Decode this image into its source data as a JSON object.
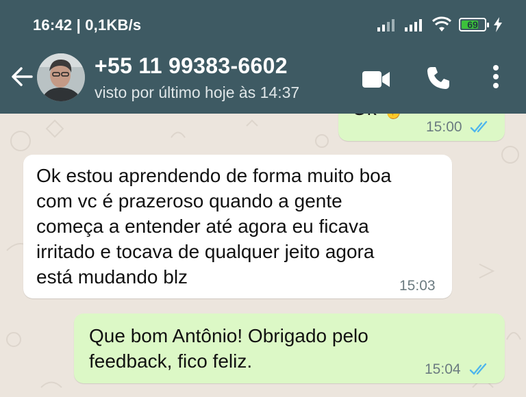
{
  "status_bar": {
    "time_speed": "16:42 | 0,1KB/s",
    "battery": "69"
  },
  "header": {
    "contact_name": "+55 11 99383-6602",
    "last_seen": "visto por último hoje às 14:37"
  },
  "messages": [
    {
      "direction": "out",
      "text": "Ok ☝",
      "time": "15:00",
      "read": true
    },
    {
      "direction": "in",
      "lines": [
        "Ok estou aprendendo de forma muito boa",
        "com vc é prazeroso quando a gente",
        "começa a entender até agora eu ficava",
        "irritado e tocava de qualquer jeito agora",
        "está mudando blz"
      ],
      "time": "15:03"
    },
    {
      "direction": "out",
      "lines": [
        "Que bom Antônio! Obrigado pelo",
        "feedback, fico feliz."
      ],
      "time": "15:04",
      "read": true
    }
  ],
  "colors": {
    "header": "#3e5a63",
    "chat_bg": "#ece5dd",
    "incoming": "#ffffff",
    "outgoing": "#dcf8c6",
    "read_ticks": "#4fb6ec"
  }
}
